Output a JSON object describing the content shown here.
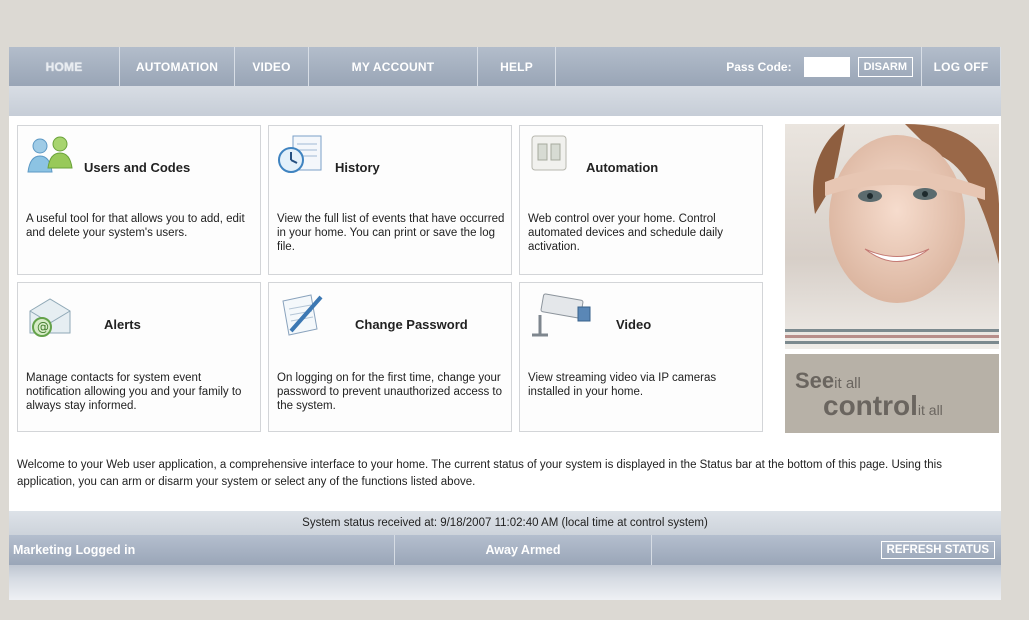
{
  "nav": {
    "tabs": [
      {
        "label": "HOME"
      },
      {
        "label": "AUTOMATION"
      },
      {
        "label": "VIDEO"
      },
      {
        "label": "MY ACCOUNT"
      },
      {
        "label": "HELP"
      }
    ],
    "passcode_label": "Pass Code:",
    "passcode_value": "",
    "disarm_label": "DISARM",
    "logoff_label": "LOG OFF"
  },
  "cards": [
    {
      "title": "Users and Codes",
      "desc": "A useful tool for that allows you to add, edit and delete your system's users.",
      "icon": "users-icon"
    },
    {
      "title": "History",
      "desc": "View the full list of events that have occurred in your home. You can print or save the log file.",
      "icon": "history-clock-icon"
    },
    {
      "title": "Automation",
      "desc": "Web control over your home. Control automated devices and schedule daily activation.",
      "icon": "light-switch-icon"
    },
    {
      "title": "Alerts",
      "desc": "Manage contacts for system event notification allowing you and your family to always stay informed.",
      "icon": "email-envelope-icon"
    },
    {
      "title": "Change Password",
      "desc": "On logging on for the first time, change your password to prevent unauthorized access to the system.",
      "icon": "pen-paper-icon"
    },
    {
      "title": "Video",
      "desc": "View streaming video via IP cameras installed in your home.",
      "icon": "security-camera-icon"
    }
  ],
  "promo": {
    "see": "See",
    "it_all_1": "it all",
    "control": "control",
    "it_all_2": "it all"
  },
  "welcome": "Welcome to your Web user application, a comprehensive interface to your home. The current status of your system is displayed in the Status bar at the bottom of this page. Using this application, you can arm or disarm your system or select any of the functions listed above.",
  "status": {
    "received": "System status received at: 9/18/2007 11:02:40 AM (local time at control system)",
    "user": "Marketing Logged in",
    "state": "Away Armed",
    "refresh_label": "REFRESH STATUS"
  }
}
